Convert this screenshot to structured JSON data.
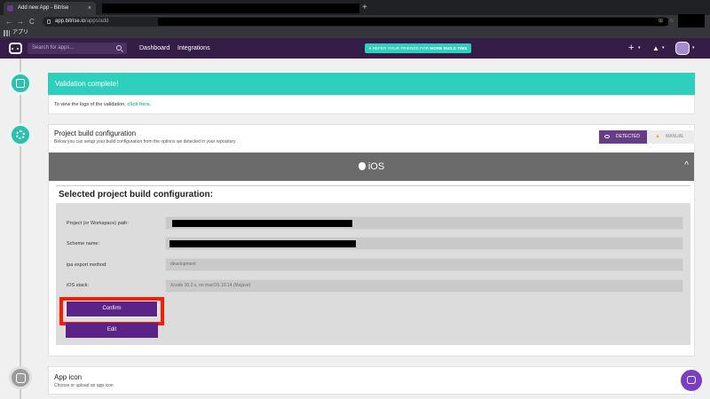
{
  "browser": {
    "tab_title": "Add new App - Bitrise",
    "tab_close": "×",
    "new_tab": "+",
    "url_host": "app.bitrise.io",
    "url_path": "/apps/add",
    "back": "←",
    "forward": "→",
    "reload": "C",
    "bookmark_label": "アプリ"
  },
  "header": {
    "search_placeholder": "Search for apps...",
    "nav": [
      "Dashboard",
      "Integrations"
    ],
    "refer_text": "REFER YOUR FRIENDS FOR ",
    "refer_bold": "MORE BUILD TIME",
    "plus": "+",
    "bell": "▲",
    "caret": "▾"
  },
  "validation": {
    "banner": "Validation complete!",
    "logs_text": "To view the logs of the validation, ",
    "logs_link": "click here."
  },
  "build": {
    "title": "Project build configuration",
    "subtitle": "Below you can setup your build configuration from the options we detected in your repository",
    "toggle_detected": "DETECTED",
    "toggle_manual": "MANUAL",
    "platform": "iOS",
    "collapse": "^",
    "selected_title": "Selected project build configuration:",
    "fields": [
      {
        "label": "Project (or Workspace) path:",
        "value": ""
      },
      {
        "label": "Scheme name:",
        "value": ""
      },
      {
        "label": "ipa export method:",
        "value": "development"
      },
      {
        "label": "iOS stack:",
        "value": "Xcode 10.2.x, on macOS 10.14 (Mojave)"
      }
    ],
    "confirm": "Confirm",
    "edit": "Edit"
  },
  "app_icon": {
    "title": "App icon",
    "subtitle": "Choose or upload an app icon"
  },
  "colors": {
    "brand_purple": "#683d87",
    "teal": "#2fcfbd",
    "highlight": "#ff1a00"
  }
}
